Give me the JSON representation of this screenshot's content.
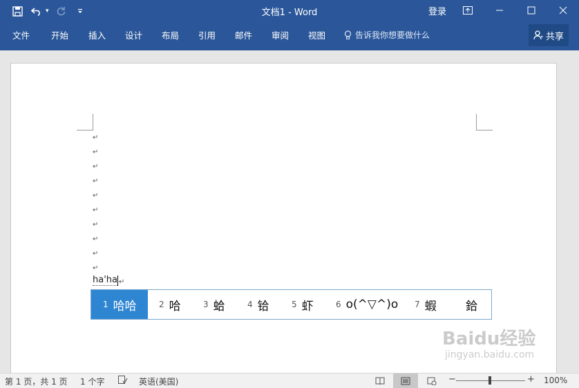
{
  "titlebar": {
    "doc_title": "文档1 - Word",
    "signin_label": "登录"
  },
  "ribbon": {
    "tabs": [
      "文件",
      "开始",
      "插入",
      "设计",
      "布局",
      "引用",
      "邮件",
      "审阅",
      "视图"
    ],
    "tell_me": "告诉我你想要做什么",
    "share_label": "共享"
  },
  "document": {
    "paragraph_mark": "↵",
    "typed_text": "ha'ha"
  },
  "ime": {
    "candidates": [
      {
        "num": "1",
        "text": "哈哈"
      },
      {
        "num": "2",
        "text": "哈"
      },
      {
        "num": "3",
        "text": "蛤"
      },
      {
        "num": "4",
        "text": "铪"
      },
      {
        "num": "5",
        "text": "虾"
      },
      {
        "num": "6",
        "text": "o(^▽^)o"
      },
      {
        "num": "7",
        "text": "蝦"
      },
      {
        "num": "",
        "text": "鉿"
      }
    ],
    "selected_index": 0
  },
  "statusbar": {
    "page_info": "第 1 页，共 1 页",
    "word_count": "1 个字",
    "language": "英语(美国)",
    "zoom": "100%"
  },
  "watermark": {
    "brand": "Baidu经验",
    "url": "jingyan.baidu.com"
  },
  "colors": {
    "accent": "#2b579a",
    "ime_selected": "#2e86d2"
  }
}
